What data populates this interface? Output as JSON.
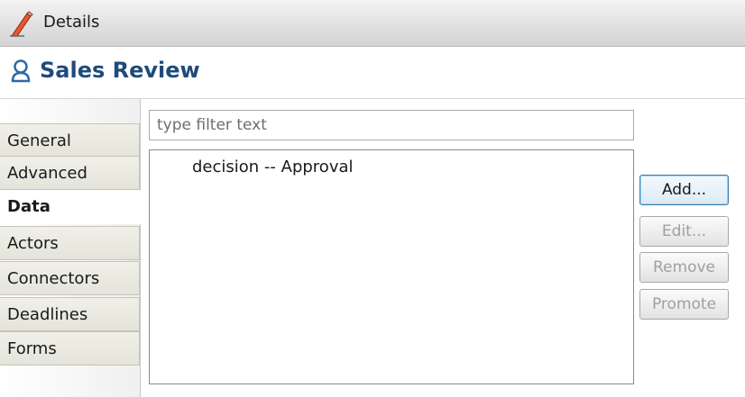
{
  "view": {
    "title": "Details"
  },
  "header": {
    "title": "Sales Review"
  },
  "tabs": [
    {
      "label": "General"
    },
    {
      "label": "Advanced"
    },
    {
      "label": "Data"
    },
    {
      "label": "Actors"
    },
    {
      "label": "Connectors"
    },
    {
      "label": "Deadlines"
    },
    {
      "label": "Forms"
    }
  ],
  "active_tab": "Data",
  "filter": {
    "placeholder": "type filter text"
  },
  "list": {
    "items": [
      {
        "label": "decision -- Approval"
      }
    ]
  },
  "buttons": {
    "add": "Add...",
    "edit": "Edit...",
    "remove": "Remove",
    "promote": "Promote"
  },
  "colors": {
    "header_text": "#1f4b7a",
    "accent_border": "#3c7fb1"
  },
  "icons": {
    "view": "pencil-icon",
    "header": "person-icon"
  }
}
